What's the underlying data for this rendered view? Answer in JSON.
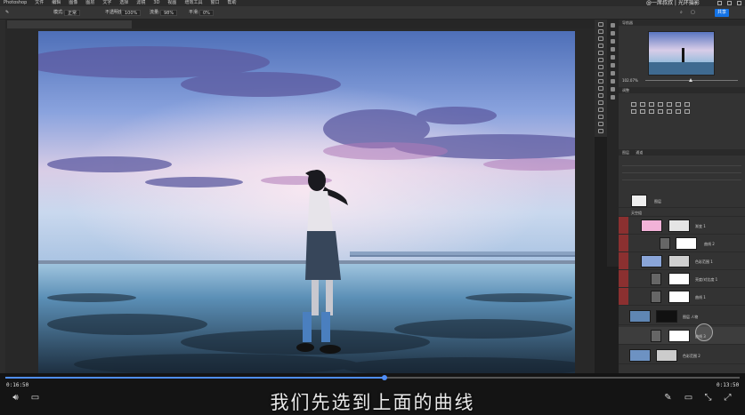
{
  "menubar": {
    "items": [
      "Photoshop",
      "文件",
      "编辑",
      "图像",
      "图层",
      "文字",
      "选择",
      "滤镜",
      "3D",
      "视图",
      "增效工具",
      "窗口",
      "帮助"
    ],
    "watermark": "@一席叔叔 | 光环摄影"
  },
  "options": {
    "mode_label": "模式:",
    "mode_value": "正常",
    "opacity_label": "不透明度:",
    "opacity_value": "100%",
    "flow_label": "流量:",
    "flow_value": "98%",
    "smooth_label": "平滑:",
    "smooth_value": "0%",
    "share": "共享"
  },
  "navigator": {
    "title": "导航器",
    "zoom": "102.07%"
  },
  "adjustments": {
    "title": "调整"
  },
  "layers": {
    "title": "图层",
    "tab2": "通道",
    "rows": [
      {
        "name": "图层"
      },
      {
        "name": "天空组"
      },
      {
        "name": "渐变 1"
      },
      {
        "name": "曲线 2"
      },
      {
        "name": "色彩范围 1"
      },
      {
        "name": "亮度/对比度 1"
      },
      {
        "name": "曲线 1"
      },
      {
        "name": "图层 人物"
      },
      {
        "name": "曲线 3"
      },
      {
        "name": "色彩范围 2"
      }
    ]
  },
  "player": {
    "current_time": "0:16:50",
    "total_time": "0:13:50",
    "progress": 0.516,
    "subtitle": "我们先选到上面的曲线"
  }
}
